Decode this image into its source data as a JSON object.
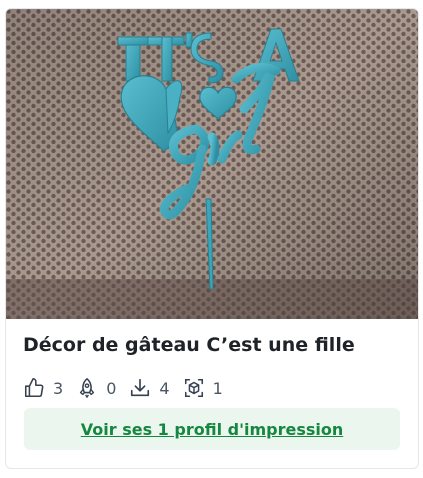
{
  "card": {
    "image_alt": "Décor de gâteau C'est une fille",
    "image_lettering": "IT'S A girl",
    "title": "Décor de gâteau C’est une fille",
    "stats": {
      "likes": "3",
      "boosts": "0",
      "downloads": "4",
      "makes": "1"
    },
    "profile_button_label": "Voir ses 1 profil d'impression"
  },
  "colors": {
    "accent_green": "#16873f",
    "button_bg": "#eaf6ee",
    "topper_blue": "#3aa6b9"
  },
  "icons": [
    "thumbs-up-icon",
    "rocket-icon",
    "download-icon",
    "cube-icon"
  ]
}
